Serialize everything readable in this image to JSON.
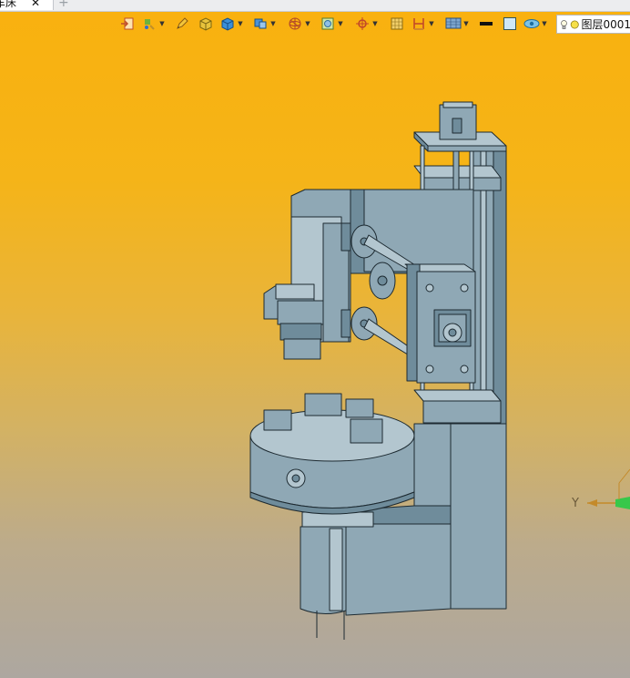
{
  "tab": {
    "title": "车床",
    "close": "✕",
    "new_tab": "+"
  },
  "toolbar": {
    "items": [
      "import-icon",
      "paint-icon",
      "pencil-icon",
      "shaded-box-icon",
      "solid-box-icon",
      "view-cube-icon",
      "wireframe-sphere-icon",
      "frame-icon",
      "snap-target-icon",
      "grid-icon",
      "dimension-icon",
      "layers-stack-icon",
      "color-swatch-black",
      "color-swatch-light",
      "visibility-icon"
    ],
    "layer_label": "图层0001"
  },
  "axis": {
    "y_label": "Y"
  },
  "colors": {
    "model": "#8fa8b5",
    "model_dark": "#6f8c9b",
    "model_light": "#b3c6cf",
    "outline": "#1d2a31",
    "bg_top": "#f9b10f",
    "bg_bottom": "#ada7a0"
  }
}
